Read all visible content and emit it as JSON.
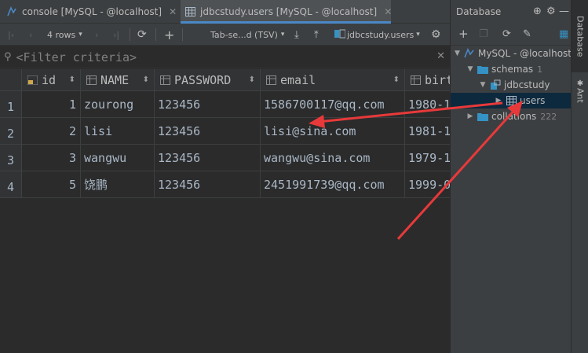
{
  "tabs": [
    {
      "label": "console [MySQL - @localhost]",
      "icon": "console-icon"
    },
    {
      "label": "jdbcstudy.users [MySQL - @localhost]",
      "icon": "table-icon"
    }
  ],
  "toolbar": {
    "rows_label": "4 rows",
    "format_label": "Tab-se...d (TSV)",
    "target_label": "jdbcstudy.users"
  },
  "filter": {
    "placeholder": "<Filter criteria>"
  },
  "columns": [
    {
      "name": "id",
      "icon": "key-column-icon"
    },
    {
      "name": "NAME",
      "icon": "column-icon"
    },
    {
      "name": "PASSWORD",
      "icon": "column-icon"
    },
    {
      "name": "email",
      "icon": "column-icon"
    },
    {
      "name": "birt",
      "icon": "column-icon"
    }
  ],
  "rows": [
    {
      "num": "1",
      "id": "1",
      "name": "zourong",
      "password": "123456",
      "email": "1586700117@qq.com",
      "birthday": "1980-1"
    },
    {
      "num": "2",
      "id": "2",
      "name": "lisi",
      "password": "123456",
      "email": "lisi@sina.com",
      "birthday": "1981-1"
    },
    {
      "num": "3",
      "id": "3",
      "name": "wangwu",
      "password": "123456",
      "email": "wangwu@sina.com",
      "birthday": "1979-1"
    },
    {
      "num": "4",
      "id": "5",
      "name": "饶鹏",
      "password": "123456",
      "email": "2451991739@qq.com",
      "birthday": "1999-0"
    }
  ],
  "database_panel": {
    "title": "Database",
    "tree": {
      "datasource": "MySQL - @localhost",
      "schemas_label": "schemas",
      "schemas_count": "1",
      "schema_name": "jdbcstudy",
      "table_name": "users",
      "collations_label": "collations",
      "collations_count": "222"
    }
  },
  "side_tabs": {
    "database": "Database",
    "ant": "Ant"
  },
  "colors": {
    "background": "#2b2b2b",
    "panel": "#3c3f41",
    "accent": "#4a88c7",
    "selection": "#0d293e",
    "annotation_arrow": "#e8393a"
  }
}
